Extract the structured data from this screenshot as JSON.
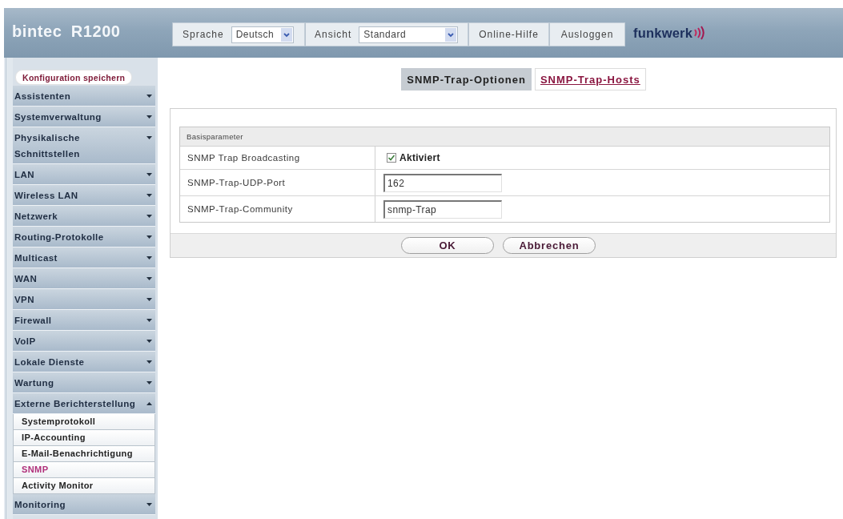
{
  "header": {
    "product": "bintec R1200",
    "language": {
      "label": "Sprache",
      "value": "Deutsch"
    },
    "view": {
      "label": "Ansicht",
      "value": "Standard"
    },
    "buttons": [
      "Online-Hilfe",
      "Ausloggen"
    ],
    "brand": "funkwerk"
  },
  "sidebar": {
    "save_button": "Konfiguration speichern",
    "items": [
      {
        "label": "Assistenten",
        "expanded": false
      },
      {
        "label": "Systemverwaltung",
        "expanded": false
      },
      {
        "label": "Physikalische Schnittstellen",
        "expanded": false
      },
      {
        "label": "LAN",
        "expanded": false
      },
      {
        "label": "Wireless LAN",
        "expanded": false
      },
      {
        "label": "Netzwerk",
        "expanded": false
      },
      {
        "label": "Routing-Protokolle",
        "expanded": false
      },
      {
        "label": "Multicast",
        "expanded": false
      },
      {
        "label": "WAN",
        "expanded": false
      },
      {
        "label": "VPN",
        "expanded": false
      },
      {
        "label": "Firewall",
        "expanded": false
      },
      {
        "label": "VoIP",
        "expanded": false
      },
      {
        "label": "Lokale Dienste",
        "expanded": false
      },
      {
        "label": "Wartung",
        "expanded": false
      },
      {
        "label": "Externe Berichterstellung",
        "expanded": true,
        "children": [
          {
            "label": "Systemprotokoll",
            "selected": false
          },
          {
            "label": "IP-Accounting",
            "selected": false
          },
          {
            "label": "E-Mail-Benachrichtigung",
            "selected": false
          },
          {
            "label": "SNMP",
            "selected": true
          },
          {
            "label": "Activity Monitor",
            "selected": false
          }
        ]
      },
      {
        "label": "Monitoring",
        "expanded": false
      }
    ]
  },
  "tabs": [
    {
      "label": "SNMP-Trap-Optionen",
      "selected": true
    },
    {
      "label": "SNMP-Trap-Hosts",
      "selected": false
    }
  ],
  "form": {
    "section": "Basisparameter",
    "rows": [
      {
        "kind": "checkbox",
        "label": "SNMP Trap Broadcasting",
        "option": "Aktiviert",
        "checked": true
      },
      {
        "kind": "text",
        "label": "SNMP-Trap-UDP-Port",
        "value": "162"
      },
      {
        "kind": "text",
        "label": "SNMP-Trap-Community",
        "value": "snmp-Trap"
      }
    ]
  },
  "buttons": [
    "OK",
    "Abbrechen"
  ]
}
